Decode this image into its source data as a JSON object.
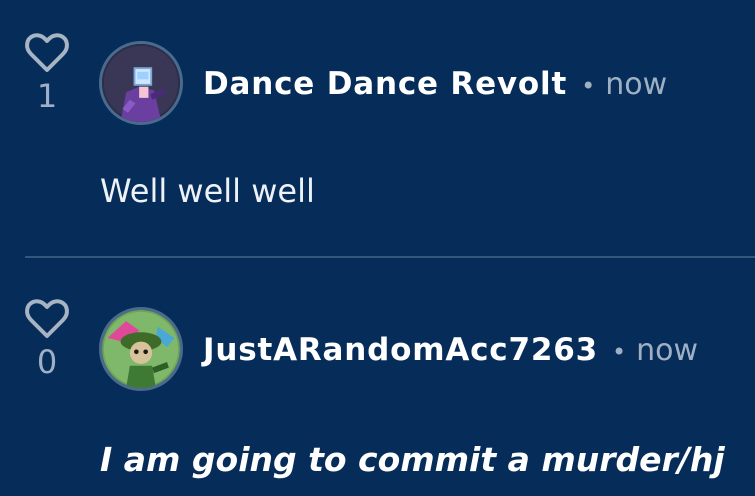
{
  "comments": [
    {
      "username": "Dance Dance Revolt",
      "separator": "•",
      "time": "now",
      "likes": "1",
      "text": "Well well well",
      "avatar_icon": "avatar-purple-character-icon"
    },
    {
      "username": "JustARandomAcc7263",
      "separator": "•",
      "time": "now",
      "likes": "0",
      "text": "I am going to commit a murder/hj",
      "avatar_icon": "avatar-green-character-icon"
    }
  ],
  "colors": {
    "background": "#062d5a",
    "muted_text": "#9fb0c4",
    "divider": "#34577d"
  }
}
